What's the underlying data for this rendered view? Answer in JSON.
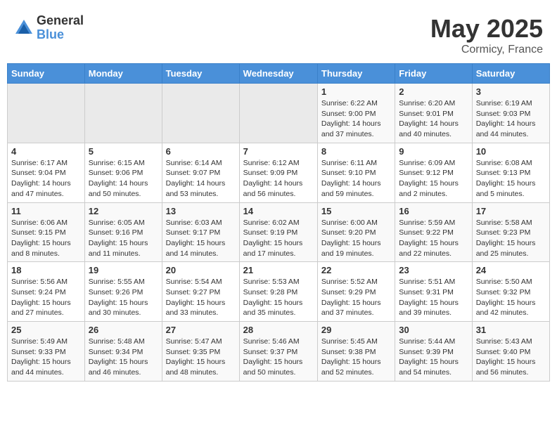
{
  "header": {
    "logo_general": "General",
    "logo_blue": "Blue",
    "title": "May 2025",
    "location": "Cormicy, France"
  },
  "columns": [
    "Sunday",
    "Monday",
    "Tuesday",
    "Wednesday",
    "Thursday",
    "Friday",
    "Saturday"
  ],
  "weeks": [
    [
      {
        "day": "",
        "detail": ""
      },
      {
        "day": "",
        "detail": ""
      },
      {
        "day": "",
        "detail": ""
      },
      {
        "day": "",
        "detail": ""
      },
      {
        "day": "1",
        "detail": "Sunrise: 6:22 AM\nSunset: 9:00 PM\nDaylight: 14 hours\nand 37 minutes."
      },
      {
        "day": "2",
        "detail": "Sunrise: 6:20 AM\nSunset: 9:01 PM\nDaylight: 14 hours\nand 40 minutes."
      },
      {
        "day": "3",
        "detail": "Sunrise: 6:19 AM\nSunset: 9:03 PM\nDaylight: 14 hours\nand 44 minutes."
      }
    ],
    [
      {
        "day": "4",
        "detail": "Sunrise: 6:17 AM\nSunset: 9:04 PM\nDaylight: 14 hours\nand 47 minutes."
      },
      {
        "day": "5",
        "detail": "Sunrise: 6:15 AM\nSunset: 9:06 PM\nDaylight: 14 hours\nand 50 minutes."
      },
      {
        "day": "6",
        "detail": "Sunrise: 6:14 AM\nSunset: 9:07 PM\nDaylight: 14 hours\nand 53 minutes."
      },
      {
        "day": "7",
        "detail": "Sunrise: 6:12 AM\nSunset: 9:09 PM\nDaylight: 14 hours\nand 56 minutes."
      },
      {
        "day": "8",
        "detail": "Sunrise: 6:11 AM\nSunset: 9:10 PM\nDaylight: 14 hours\nand 59 minutes."
      },
      {
        "day": "9",
        "detail": "Sunrise: 6:09 AM\nSunset: 9:12 PM\nDaylight: 15 hours\nand 2 minutes."
      },
      {
        "day": "10",
        "detail": "Sunrise: 6:08 AM\nSunset: 9:13 PM\nDaylight: 15 hours\nand 5 minutes."
      }
    ],
    [
      {
        "day": "11",
        "detail": "Sunrise: 6:06 AM\nSunset: 9:15 PM\nDaylight: 15 hours\nand 8 minutes."
      },
      {
        "day": "12",
        "detail": "Sunrise: 6:05 AM\nSunset: 9:16 PM\nDaylight: 15 hours\nand 11 minutes."
      },
      {
        "day": "13",
        "detail": "Sunrise: 6:03 AM\nSunset: 9:17 PM\nDaylight: 15 hours\nand 14 minutes."
      },
      {
        "day": "14",
        "detail": "Sunrise: 6:02 AM\nSunset: 9:19 PM\nDaylight: 15 hours\nand 17 minutes."
      },
      {
        "day": "15",
        "detail": "Sunrise: 6:00 AM\nSunset: 9:20 PM\nDaylight: 15 hours\nand 19 minutes."
      },
      {
        "day": "16",
        "detail": "Sunrise: 5:59 AM\nSunset: 9:22 PM\nDaylight: 15 hours\nand 22 minutes."
      },
      {
        "day": "17",
        "detail": "Sunrise: 5:58 AM\nSunset: 9:23 PM\nDaylight: 15 hours\nand 25 minutes."
      }
    ],
    [
      {
        "day": "18",
        "detail": "Sunrise: 5:56 AM\nSunset: 9:24 PM\nDaylight: 15 hours\nand 27 minutes."
      },
      {
        "day": "19",
        "detail": "Sunrise: 5:55 AM\nSunset: 9:26 PM\nDaylight: 15 hours\nand 30 minutes."
      },
      {
        "day": "20",
        "detail": "Sunrise: 5:54 AM\nSunset: 9:27 PM\nDaylight: 15 hours\nand 33 minutes."
      },
      {
        "day": "21",
        "detail": "Sunrise: 5:53 AM\nSunset: 9:28 PM\nDaylight: 15 hours\nand 35 minutes."
      },
      {
        "day": "22",
        "detail": "Sunrise: 5:52 AM\nSunset: 9:29 PM\nDaylight: 15 hours\nand 37 minutes."
      },
      {
        "day": "23",
        "detail": "Sunrise: 5:51 AM\nSunset: 9:31 PM\nDaylight: 15 hours\nand 39 minutes."
      },
      {
        "day": "24",
        "detail": "Sunrise: 5:50 AM\nSunset: 9:32 PM\nDaylight: 15 hours\nand 42 minutes."
      }
    ],
    [
      {
        "day": "25",
        "detail": "Sunrise: 5:49 AM\nSunset: 9:33 PM\nDaylight: 15 hours\nand 44 minutes."
      },
      {
        "day": "26",
        "detail": "Sunrise: 5:48 AM\nSunset: 9:34 PM\nDaylight: 15 hours\nand 46 minutes."
      },
      {
        "day": "27",
        "detail": "Sunrise: 5:47 AM\nSunset: 9:35 PM\nDaylight: 15 hours\nand 48 minutes."
      },
      {
        "day": "28",
        "detail": "Sunrise: 5:46 AM\nSunset: 9:37 PM\nDaylight: 15 hours\nand 50 minutes."
      },
      {
        "day": "29",
        "detail": "Sunrise: 5:45 AM\nSunset: 9:38 PM\nDaylight: 15 hours\nand 52 minutes."
      },
      {
        "day": "30",
        "detail": "Sunrise: 5:44 AM\nSunset: 9:39 PM\nDaylight: 15 hours\nand 54 minutes."
      },
      {
        "day": "31",
        "detail": "Sunrise: 5:43 AM\nSunset: 9:40 PM\nDaylight: 15 hours\nand 56 minutes."
      }
    ]
  ]
}
